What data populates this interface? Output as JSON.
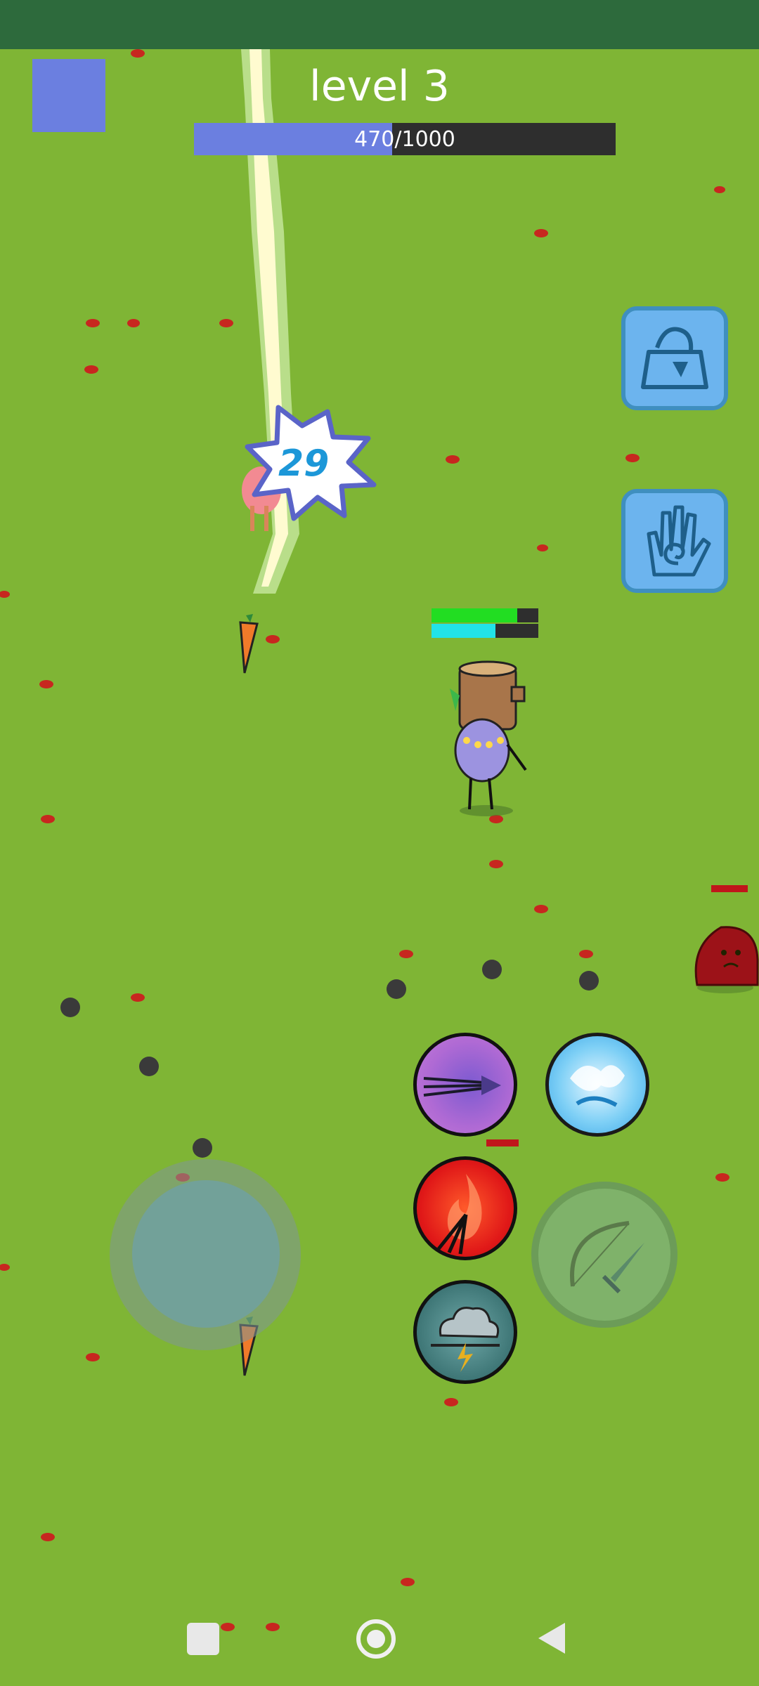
{
  "hud": {
    "level_label": "level 3",
    "xp_current": "470",
    "xp_separator": "/",
    "xp_max": "1000",
    "xp_fraction": 0.47
  },
  "player": {
    "health_fraction": 0.8,
    "mana_fraction": 0.6
  },
  "combat": {
    "damage_number": "29"
  },
  "buttons": {
    "inventory_icon": "bag-icon",
    "spell_icon": "spiral-hand-icon",
    "skill_1_icon": "arrow-burst-icon",
    "skill_2_icon": "water-splash-icon",
    "skill_3_icon": "fire-arrows-icon",
    "skill_4_icon": "storm-cloud-icon",
    "attack_icon": "bow-sword-icon"
  },
  "colors": {
    "grass": "#7fb535",
    "xp_fill": "#6b7fe0",
    "health": "#22dd22",
    "mana": "#22e3e8",
    "enemy": "#9c1218"
  },
  "nav": {
    "recent_icon": "square-icon",
    "home_icon": "circle-icon",
    "back_icon": "triangle-back-icon"
  }
}
